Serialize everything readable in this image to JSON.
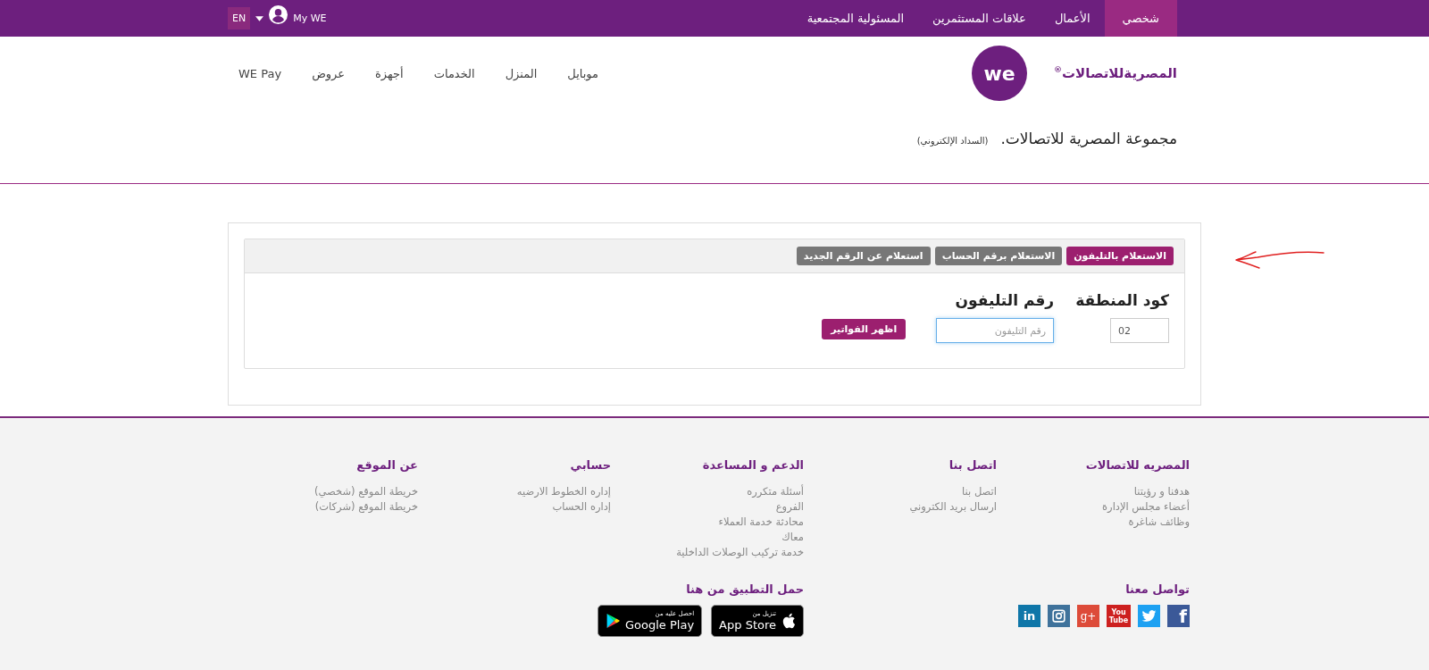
{
  "top_bar": {
    "language": "EN",
    "account": "My WE",
    "links": [
      {
        "label": "شخصي",
        "selected": true
      },
      {
        "label": "الأعمال",
        "selected": false
      },
      {
        "label": "علاقات المستثمرين",
        "selected": false
      },
      {
        "label": "المسئولية المجتمعية",
        "selected": false
      }
    ]
  },
  "header": {
    "logo_text": "المصريةللاتصالات",
    "logo_mark": "®",
    "badge": "we",
    "nav": [
      "موبايل",
      "المنزل",
      "الخدمات",
      "أجهزة",
      "عروض",
      "WE Pay"
    ]
  },
  "breadcrumb": {
    "title": "مجموعة المصرية للاتصالات.",
    "subtitle": "(السداد الإلكتروني)"
  },
  "inquiry": {
    "tabs": [
      {
        "label": "الاستعلام بالتليفون",
        "selected": true
      },
      {
        "label": "الاستعلام برقم الحساب",
        "selected": false
      },
      {
        "label": "استعلام عن الرقم الجديد",
        "selected": false
      }
    ],
    "fields": [
      {
        "label": "كود المنطقة",
        "value": "02",
        "focused": false
      },
      {
        "label": "رقم التليفون",
        "placeholder": "رقم التليفون",
        "focused": true
      }
    ],
    "button": "اظهر الفواتير"
  },
  "footer": {
    "columns": [
      {
        "title": "المصريه للاتصالات",
        "links": [
          "هدفنا و رؤيتنا",
          "أعضاء مجلس الإدارة",
          "وظائف شاغرة"
        ]
      },
      {
        "title": "اتصل بنا",
        "links": [
          "اتصل بنا",
          "ارسال بريد الكتروني"
        ]
      },
      {
        "title": "الدعم و المساعدة",
        "links": [
          "أسئلة متكرره",
          "الفروع",
          "محادثة خدمة العملاء",
          "معاك",
          "خدمة تركيب الوصلات الداخلية"
        ]
      },
      {
        "title": "حسابي",
        "links": [
          "إداره الخطوط الارضيه",
          "إداره الحساب"
        ]
      },
      {
        "title": "عن الموقع",
        "links": [
          "خريطة الموقع (شخصي)",
          "خريطة الموقع (شركات)"
        ]
      }
    ],
    "social": {
      "title": "تواصل معنا",
      "icons": [
        {
          "kind": "facebook",
          "label": "f"
        },
        {
          "kind": "twitter"
        },
        {
          "kind": "youtube",
          "label": "You Tube"
        },
        {
          "kind": "gplus",
          "label": "g+"
        },
        {
          "kind": "instagram"
        },
        {
          "kind": "linkedin",
          "label": "in"
        }
      ]
    },
    "apps": {
      "title": "حمل التطبيق من هنا",
      "badges": [
        {
          "kind": "apple",
          "caption": "تنزيل من",
          "name": "App Store"
        },
        {
          "kind": "google",
          "caption": "احصل عليه من",
          "name": "Google Play"
        }
      ]
    }
  }
}
